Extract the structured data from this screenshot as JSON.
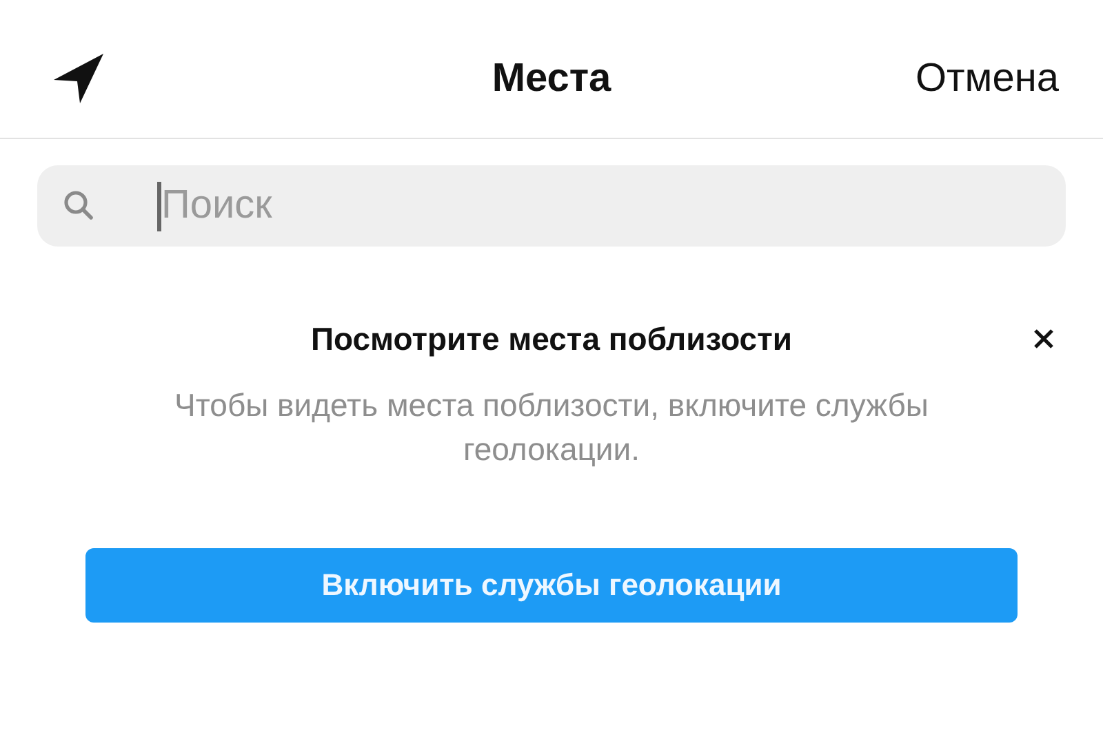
{
  "header": {
    "title": "Места",
    "cancel": "Отмена"
  },
  "search": {
    "placeholder": "Поиск"
  },
  "notice": {
    "title": "Посмотрите места поблизости",
    "text": "Чтобы видеть места поблизости, включите службы геолокации.",
    "button": "Включить службы геолокации"
  }
}
